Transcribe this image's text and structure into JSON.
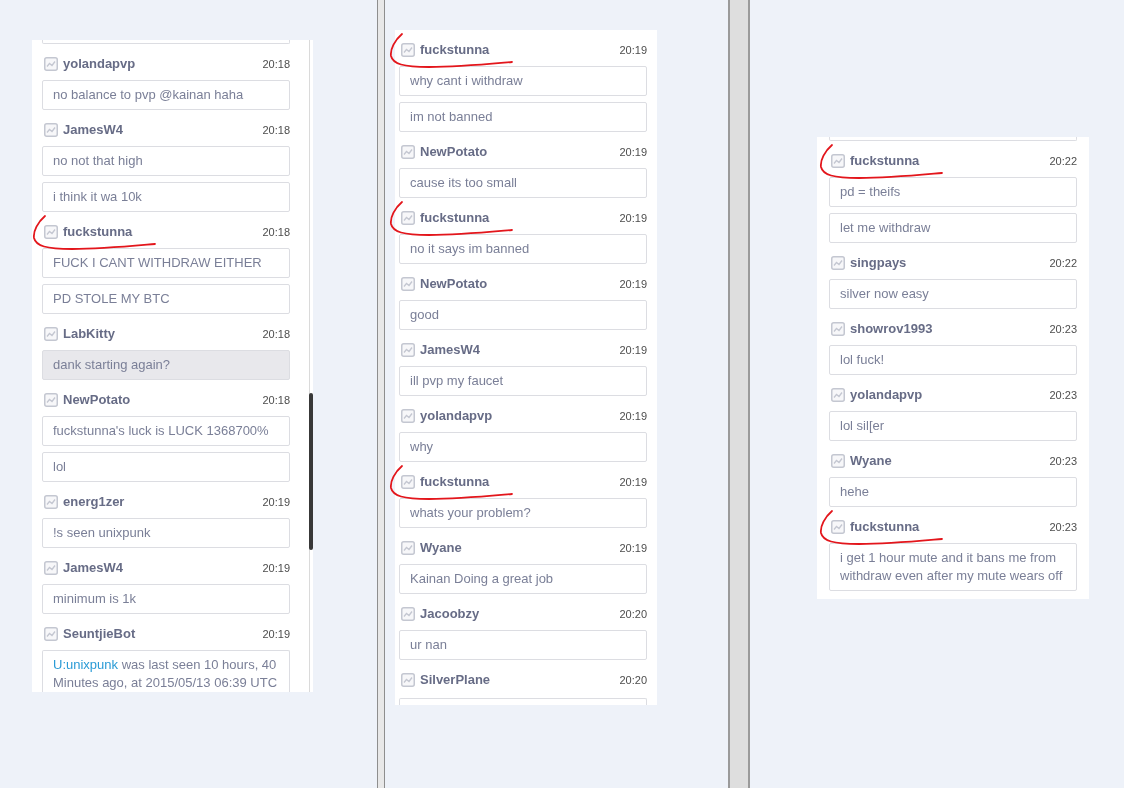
{
  "panels": [
    {
      "clipped_above": true,
      "clipped_below": true,
      "scrollbar": true,
      "groups": [
        {
          "user": "yolandapvp",
          "time": "20:18",
          "marked": false,
          "messages": [
            {
              "kind": "text",
              "text": "no balance to pvp @kainan haha",
              "highlighted": false
            }
          ]
        },
        {
          "user": "JamesW4",
          "time": "20:18",
          "marked": false,
          "messages": [
            {
              "kind": "text",
              "text": "no not that high",
              "highlighted": false
            },
            {
              "kind": "text",
              "text": "i think it wa 10k",
              "highlighted": false
            }
          ]
        },
        {
          "user": "fuckstunna",
          "time": "20:18",
          "marked": true,
          "messages": [
            {
              "kind": "text",
              "text": "FUCK I CANT WITHDRAW EITHER",
              "highlighted": false
            },
            {
              "kind": "text",
              "text": "PD STOLE MY BTC",
              "highlighted": false
            }
          ]
        },
        {
          "user": "LabKitty",
          "time": "20:18",
          "marked": false,
          "messages": [
            {
              "kind": "text",
              "text": "dank starting again?",
              "highlighted": true
            }
          ]
        },
        {
          "user": "NewPotato",
          "time": "20:18",
          "marked": false,
          "messages": [
            {
              "kind": "text",
              "text": "fuckstunna's luck is LUCK 1368700%",
              "highlighted": false
            },
            {
              "kind": "text",
              "text": "lol",
              "highlighted": false
            }
          ]
        },
        {
          "user": "energ1zer",
          "time": "20:19",
          "marked": false,
          "messages": [
            {
              "kind": "text",
              "text": "!s seen unixpunk",
              "highlighted": false
            }
          ]
        },
        {
          "user": "JamesW4",
          "time": "20:19",
          "marked": false,
          "messages": [
            {
              "kind": "text",
              "text": "minimum is 1k",
              "highlighted": false
            }
          ]
        },
        {
          "user": "SeuntjieBot",
          "time": "20:19",
          "marked": false,
          "messages": [
            {
              "kind": "link_text",
              "link": "U:unixpunk",
              "text": "was last seen 10 hours, 40 Minutes ago, at 2015/05/13 06:39 UTC",
              "highlighted": false
            }
          ]
        }
      ]
    },
    {
      "clipped_above": false,
      "clipped_below": true,
      "scrollbar": false,
      "groups": [
        {
          "user": "fuckstunna",
          "time": "20:19",
          "marked": true,
          "messages": [
            {
              "kind": "text",
              "text": "why cant i withdraw",
              "highlighted": false
            },
            {
              "kind": "text",
              "text": "im not banned",
              "highlighted": false
            }
          ]
        },
        {
          "user": "NewPotato",
          "time": "20:19",
          "marked": false,
          "messages": [
            {
              "kind": "text",
              "text": "cause its too small",
              "highlighted": false
            }
          ]
        },
        {
          "user": "fuckstunna",
          "time": "20:19",
          "marked": true,
          "messages": [
            {
              "kind": "text",
              "text": "no it says im banned",
              "highlighted": false
            }
          ]
        },
        {
          "user": "NewPotato",
          "time": "20:19",
          "marked": false,
          "messages": [
            {
              "kind": "text",
              "text": "good",
              "highlighted": false
            }
          ]
        },
        {
          "user": "JamesW4",
          "time": "20:19",
          "marked": false,
          "messages": [
            {
              "kind": "text",
              "text": "ill pvp my faucet",
              "highlighted": false
            }
          ]
        },
        {
          "user": "yolandapvp",
          "time": "20:19",
          "marked": false,
          "messages": [
            {
              "kind": "text",
              "text": "why",
              "highlighted": false
            }
          ]
        },
        {
          "user": "fuckstunna",
          "time": "20:19",
          "marked": true,
          "messages": [
            {
              "kind": "text",
              "text": "whats your problem?",
              "highlighted": false
            }
          ]
        },
        {
          "user": "Wyane",
          "time": "20:19",
          "marked": false,
          "messages": [
            {
              "kind": "text",
              "text": "Kainan Doing a great job",
              "highlighted": false
            }
          ]
        },
        {
          "user": "Jacoobzy",
          "time": "20:20",
          "marked": false,
          "messages": [
            {
              "kind": "text",
              "text": "ur nan",
              "highlighted": false
            }
          ]
        },
        {
          "user": "SilverPlane",
          "time": "20:20",
          "marked": false
        }
      ]
    },
    {
      "clipped_above": true,
      "clipped_below": false,
      "scrollbar": false,
      "groups": [
        {
          "user": "fuckstunna",
          "time": "20:22",
          "marked": true,
          "messages": [
            {
              "kind": "text",
              "text": "pd = theifs",
              "highlighted": false
            },
            {
              "kind": "text",
              "text": "let me withdraw",
              "highlighted": false
            }
          ]
        },
        {
          "user": "singpays",
          "time": "20:22",
          "marked": false,
          "messages": [
            {
              "kind": "text",
              "text": "silver now easy",
              "highlighted": false
            }
          ]
        },
        {
          "user": "showrov1993",
          "time": "20:23",
          "marked": false,
          "messages": [
            {
              "kind": "text",
              "text": "lol fuck!",
              "highlighted": false
            }
          ]
        },
        {
          "user": "yolandapvp",
          "time": "20:23",
          "marked": false,
          "messages": [
            {
              "kind": "text",
              "text": "lol sil[er",
              "highlighted": false
            }
          ]
        },
        {
          "user": "Wyane",
          "time": "20:23",
          "marked": false,
          "messages": [
            {
              "kind": "text",
              "text": "hehe",
              "highlighted": false
            }
          ]
        },
        {
          "user": "fuckstunna",
          "time": "20:23",
          "marked": true,
          "messages": [
            {
              "kind": "text",
              "text": "i get 1 hour mute and it bans me from withdraw even after my mute wears off",
              "highlighted": false
            }
          ]
        }
      ]
    }
  ]
}
